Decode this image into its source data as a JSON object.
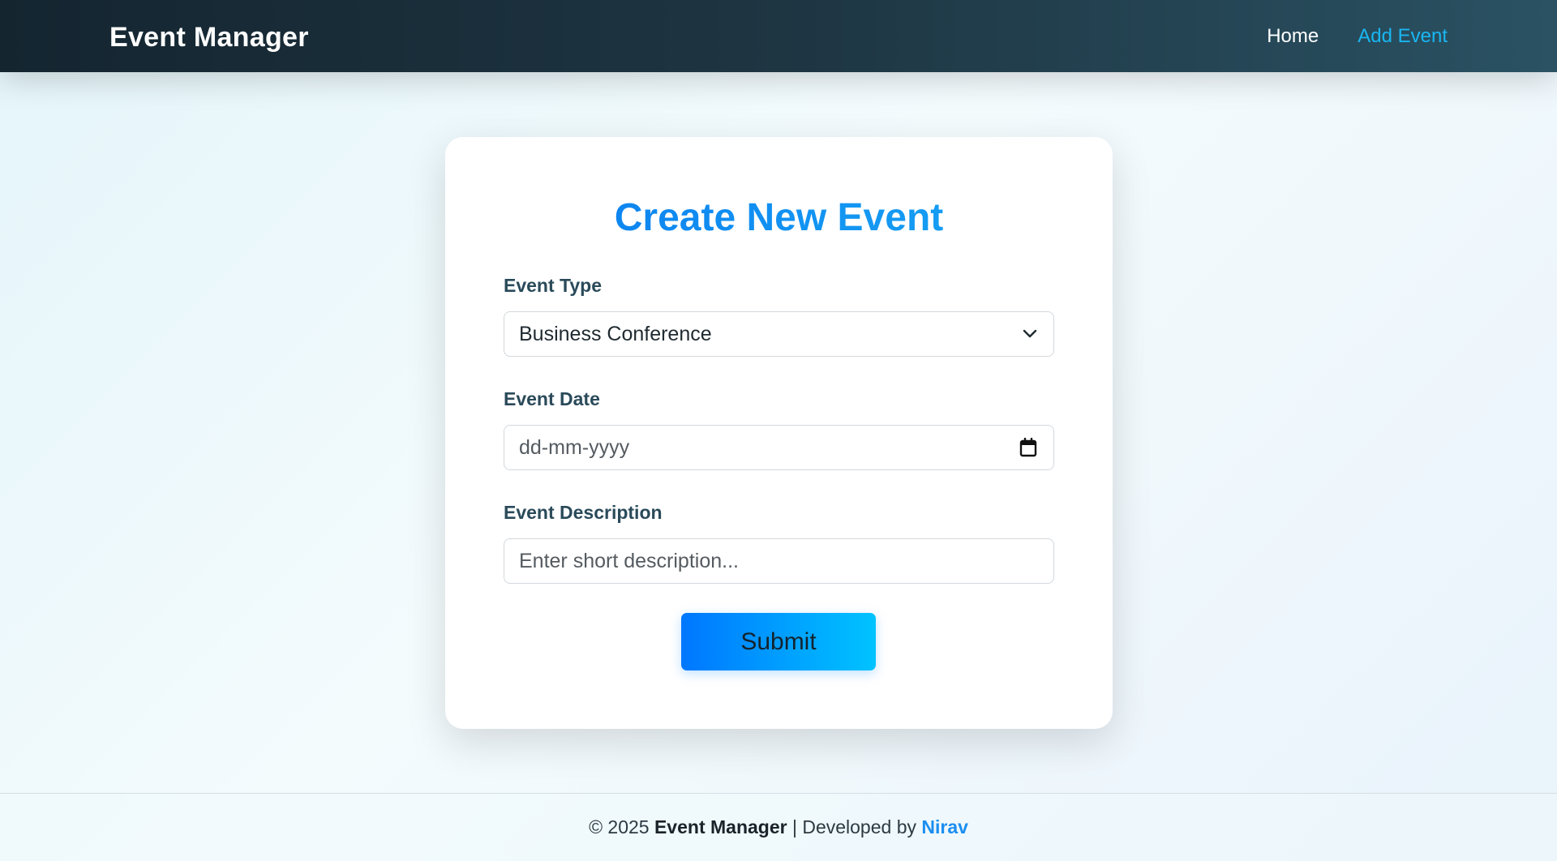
{
  "navbar": {
    "brand": "Event Manager",
    "links": [
      {
        "label": "Home",
        "active": false
      },
      {
        "label": "Add Event",
        "active": true
      }
    ]
  },
  "form": {
    "title": "Create New Event",
    "event_type": {
      "label": "Event Type",
      "selected_value": "Business Conference",
      "icon": "chevron-down-icon"
    },
    "event_date": {
      "label": "Event Date",
      "placeholder": "dd-mm-yyyy",
      "icon": "calendar-icon"
    },
    "event_description": {
      "label": "Event Description",
      "placeholder": "Enter short description..."
    },
    "submit_label": "Submit"
  },
  "footer": {
    "copyright": "© 2025 ",
    "app_name": "Event Manager",
    "separator": " | Developed by ",
    "author": "Nirav"
  },
  "colors": {
    "navbar_start": "#142530",
    "navbar_end": "#2a5263",
    "accent": "#19b6f2",
    "title_blue": "#1a8ef0",
    "button_start": "#0077ff",
    "button_end": "#00c3ff"
  }
}
